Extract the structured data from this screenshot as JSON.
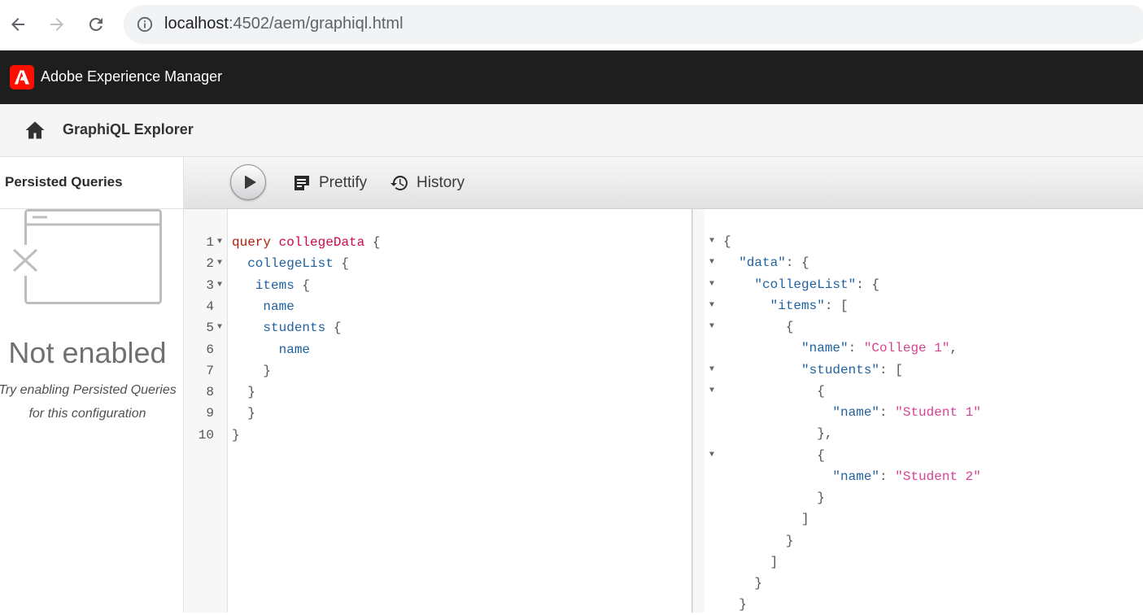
{
  "browser": {
    "url_host": "localhost",
    "url_rest": ":4502/aem/graphiql.html"
  },
  "app": {
    "title": "Adobe Experience Manager"
  },
  "subheader": {
    "title": "GraphiQL Explorer"
  },
  "sidebar": {
    "heading": "Persisted Queries",
    "empty_title": "Not enabled",
    "empty_desc_line1": "Try enabling Persisted Queries",
    "empty_desc_line2": "for this configuration"
  },
  "toolbar": {
    "prettify_label": "Prettify",
    "history_label": "History"
  },
  "editor": {
    "line_numbers": [
      "1",
      "2",
      "3",
      "4",
      "5",
      "6",
      "7",
      "8",
      "9",
      "10"
    ],
    "lines": [
      {
        "indent": "",
        "kw": "query",
        "def": "collegeData",
        "punc": " {"
      },
      {
        "indent": "  ",
        "prop": "collegeList",
        "punc": " {"
      },
      {
        "indent": "   ",
        "prop": "items",
        "punc": " {"
      },
      {
        "indent": "    ",
        "prop": "name",
        "punc": ""
      },
      {
        "indent": "    ",
        "prop": "students",
        "punc": " {"
      },
      {
        "indent": "      ",
        "prop": "name",
        "punc": ""
      },
      {
        "indent": "    ",
        "prop": "",
        "punc": "}"
      },
      {
        "indent": "  ",
        "prop": "",
        "punc": "}"
      },
      {
        "indent": "  ",
        "prop": "",
        "punc": "}"
      },
      {
        "indent": "",
        "prop": "",
        "punc": "}"
      }
    ]
  },
  "result": {
    "lines": [
      {
        "indent": "",
        "key": "",
        "mid": "{",
        "str": "",
        "end": ""
      },
      {
        "indent": "  ",
        "key": "\"data\"",
        "mid": ": {",
        "str": "",
        "end": ""
      },
      {
        "indent": "    ",
        "key": "\"collegeList\"",
        "mid": ": {",
        "str": "",
        "end": ""
      },
      {
        "indent": "      ",
        "key": "\"items\"",
        "mid": ": [",
        "str": "",
        "end": ""
      },
      {
        "indent": "        ",
        "key": "",
        "mid": "{",
        "str": "",
        "end": ""
      },
      {
        "indent": "          ",
        "key": "\"name\"",
        "mid": ": ",
        "str": "\"College 1\"",
        "end": ","
      },
      {
        "indent": "          ",
        "key": "\"students\"",
        "mid": ": [",
        "str": "",
        "end": ""
      },
      {
        "indent": "            ",
        "key": "",
        "mid": "{",
        "str": "",
        "end": ""
      },
      {
        "indent": "              ",
        "key": "\"name\"",
        "mid": ": ",
        "str": "\"Student 1\"",
        "end": ""
      },
      {
        "indent": "            ",
        "key": "",
        "mid": "},",
        "str": "",
        "end": ""
      },
      {
        "indent": "            ",
        "key": "",
        "mid": "{",
        "str": "",
        "end": ""
      },
      {
        "indent": "              ",
        "key": "\"name\"",
        "mid": ": ",
        "str": "\"Student 2\"",
        "end": ""
      },
      {
        "indent": "            ",
        "key": "",
        "mid": "}",
        "str": "",
        "end": ""
      },
      {
        "indent": "          ",
        "key": "",
        "mid": "]",
        "str": "",
        "end": ""
      },
      {
        "indent": "        ",
        "key": "",
        "mid": "}",
        "str": "",
        "end": ""
      },
      {
        "indent": "      ",
        "key": "",
        "mid": "]",
        "str": "",
        "end": ""
      },
      {
        "indent": "    ",
        "key": "",
        "mid": "}",
        "str": "",
        "end": ""
      },
      {
        "indent": "  ",
        "key": "",
        "mid": "}",
        "str": "",
        "end": ""
      }
    ]
  },
  "colors": {
    "aem_header": "#1e1e1e",
    "adobe_red": "#fa0f00",
    "keyword": "#b11a04",
    "definition": "#d2054e",
    "property": "#1f61a0",
    "string": "#d64292"
  }
}
